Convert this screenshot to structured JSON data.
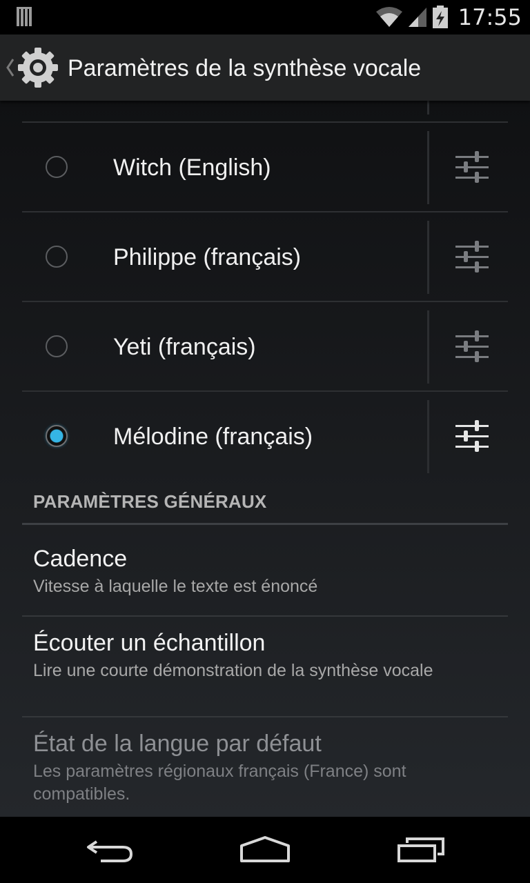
{
  "status_bar": {
    "time": "17:55",
    "icons": [
      "notification-icon",
      "wifi-icon",
      "signal-icon",
      "battery-charging-icon"
    ]
  },
  "action_bar": {
    "title": "Paramètres de la synthèse vocale",
    "icon": "gear-icon"
  },
  "engines": [
    {
      "label": "Witch (English)",
      "selected": false
    },
    {
      "label": "Philippe (français)",
      "selected": false
    },
    {
      "label": "Yeti (français)",
      "selected": false
    },
    {
      "label": "Mélodine (français)",
      "selected": true
    }
  ],
  "general": {
    "header": "PARAMÈTRES GÉNÉRAUX",
    "items": [
      {
        "title": "Cadence",
        "summary": "Vitesse à laquelle le texte est énoncé",
        "enabled": true
      },
      {
        "title": "Écouter un échantillon",
        "summary": "Lire une courte démonstration de la synthèse vocale",
        "enabled": true
      },
      {
        "title": "État de la langue par défaut",
        "summary": "Les paramètres régionaux français (France) sont compatibles.",
        "enabled": false
      }
    ]
  },
  "colors": {
    "accent": "#35b5e5",
    "background": "#1b1d20",
    "action_bar": "#222324"
  },
  "nav_bar": {
    "buttons": [
      "back-icon",
      "home-icon",
      "recent-apps-icon"
    ]
  }
}
